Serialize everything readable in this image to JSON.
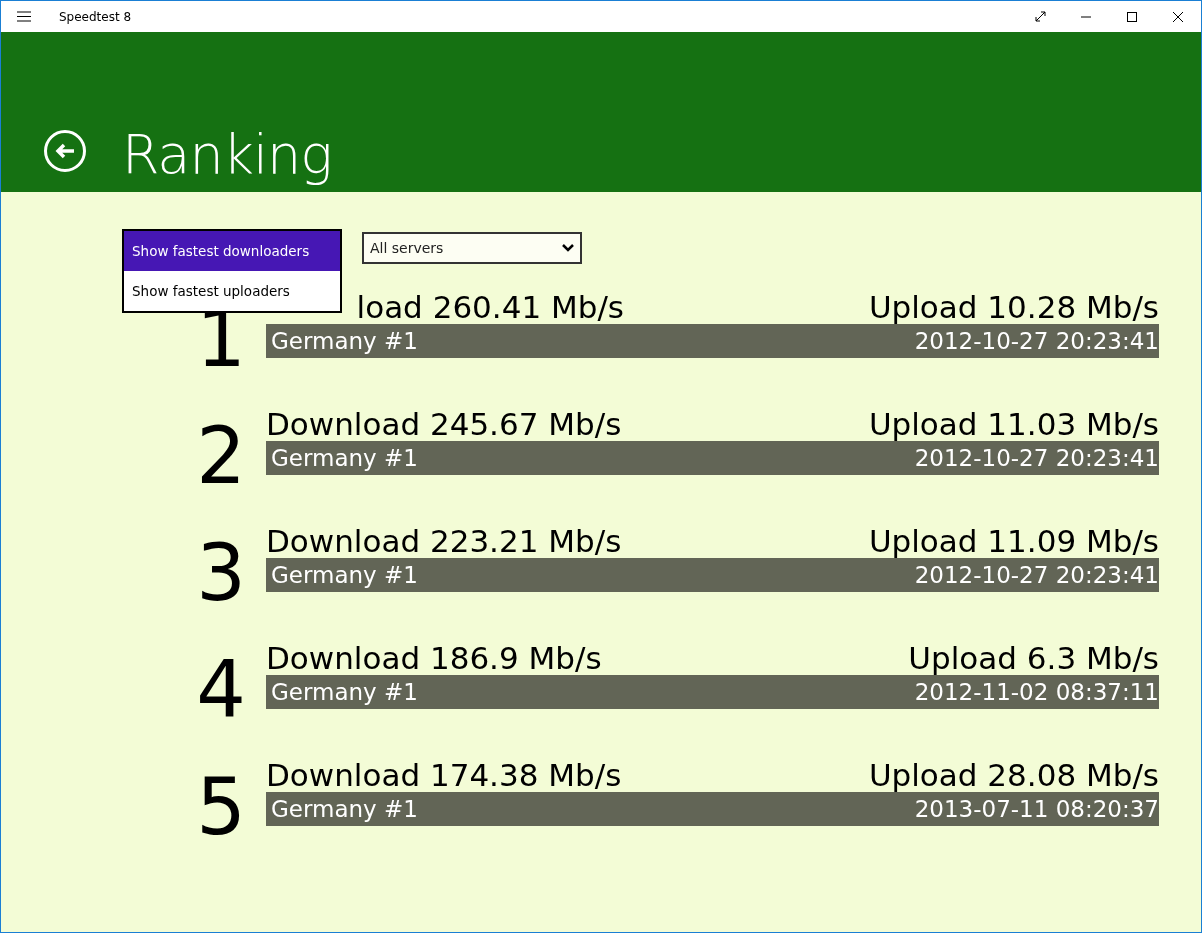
{
  "window": {
    "title": "Speedtest 8"
  },
  "header": {
    "title": "Ranking"
  },
  "server_filter": {
    "value": "All servers"
  },
  "sort_menu": [
    {
      "label": "Show fastest downloaders",
      "selected": true
    },
    {
      "label": "Show fastest uploaders",
      "selected": false
    }
  ],
  "rankings": [
    {
      "rank": "1",
      "download": "load 260.41 Mb/s",
      "covered": true,
      "upload": "Upload 10.28 Mb/s",
      "server": "Germany #1",
      "time": "2012-10-27 20:23:41"
    },
    {
      "rank": "2",
      "download": "Download 245.67 Mb/s",
      "upload": "Upload 11.03 Mb/s",
      "server": "Germany #1",
      "time": "2012-10-27 20:23:41"
    },
    {
      "rank": "3",
      "download": "Download 223.21 Mb/s",
      "upload": "Upload 11.09 Mb/s",
      "server": "Germany #1",
      "time": "2012-10-27 20:23:41"
    },
    {
      "rank": "4",
      "download": "Download 186.9 Mb/s",
      "upload": "Upload 6.3 Mb/s",
      "server": "Germany #1",
      "time": "2012-11-02 08:37:11"
    },
    {
      "rank": "5",
      "download": "Download 174.38 Mb/s",
      "upload": "Upload 28.08 Mb/s",
      "server": "Germany #1",
      "time": "2013-07-11 08:20:37"
    }
  ]
}
